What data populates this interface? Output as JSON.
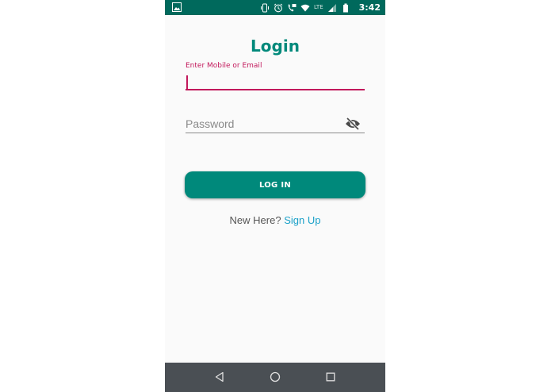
{
  "status_bar": {
    "time": "3:42",
    "lte": "LTE",
    "icons": [
      "image-icon",
      "vibrate-icon",
      "alarm-icon",
      "volte-icon",
      "wifi-icon",
      "signal-icon",
      "battery-icon"
    ]
  },
  "login": {
    "title": "Login",
    "email_label": "Enter Mobile or Email",
    "email_value": "",
    "password_placeholder": "Password",
    "password_value": "",
    "visibility_icon": "eye-off-icon",
    "button_label": "LOG IN",
    "signup_prompt": "New Here?",
    "signup_link": "Sign Up"
  },
  "nav_bar": {
    "icons": [
      "back-icon",
      "home-icon",
      "recents-icon"
    ]
  },
  "colors": {
    "status_bar": "#00695c",
    "accent": "#00897b",
    "error_focus": "#c2185b",
    "link": "#1aa0c8",
    "nav_bar": "#4a4f54"
  }
}
